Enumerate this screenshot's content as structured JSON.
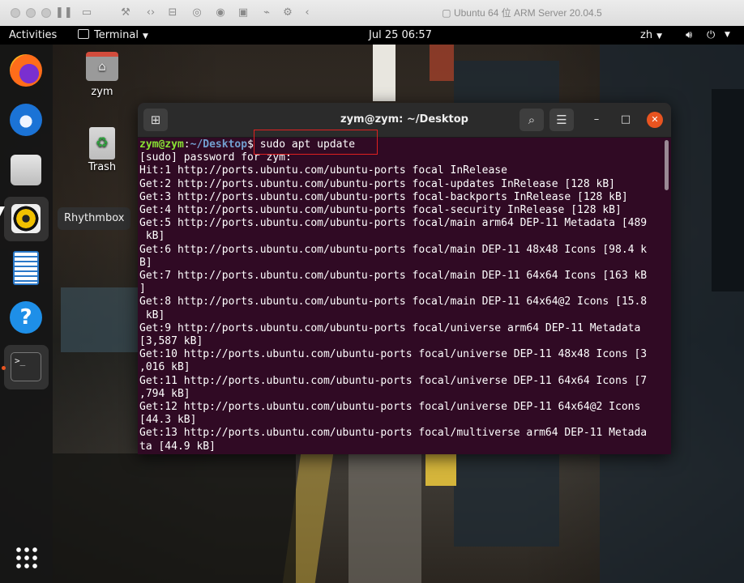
{
  "vm_window": {
    "title": "Ubuntu 64 位 ARM Server 20.04.5"
  },
  "topbar": {
    "activities": "Activities",
    "app_menu": "Terminal",
    "clock": "Jul 25  06:57",
    "input_method": "zh"
  },
  "dock": {
    "tooltip": "Rhythmbox",
    "items": [
      {
        "name": "firefox-icon"
      },
      {
        "name": "thunderbird-icon"
      },
      {
        "name": "files-icon"
      },
      {
        "name": "rhythmbox-icon"
      },
      {
        "name": "libreoffice-writer-icon"
      },
      {
        "name": "help-icon"
      },
      {
        "name": "terminal-icon"
      },
      {
        "name": "show-apps-icon"
      }
    ]
  },
  "desktop_icons": {
    "home": "zym",
    "trash": "Trash"
  },
  "terminal": {
    "title": "zym@zym: ~/Desktop",
    "prompt_user": "zym@zym",
    "prompt_sep": ":",
    "prompt_path": "~/Desktop",
    "prompt_symbol": "$",
    "command": " sudo apt update",
    "lines": [
      "[sudo] password for zym:",
      "Hit:1 http://ports.ubuntu.com/ubuntu-ports focal InRelease",
      "Get:2 http://ports.ubuntu.com/ubuntu-ports focal-updates InRelease [128 kB]",
      "Get:3 http://ports.ubuntu.com/ubuntu-ports focal-backports InRelease [128 kB]",
      "Get:4 http://ports.ubuntu.com/ubuntu-ports focal-security InRelease [128 kB]",
      "Get:5 http://ports.ubuntu.com/ubuntu-ports focal/main arm64 DEP-11 Metadata [489",
      " kB]",
      "Get:6 http://ports.ubuntu.com/ubuntu-ports focal/main DEP-11 48x48 Icons [98.4 k",
      "B]",
      "Get:7 http://ports.ubuntu.com/ubuntu-ports focal/main DEP-11 64x64 Icons [163 kB",
      "]",
      "Get:8 http://ports.ubuntu.com/ubuntu-ports focal/main DEP-11 64x64@2 Icons [15.8",
      " kB]",
      "Get:9 http://ports.ubuntu.com/ubuntu-ports focal/universe arm64 DEP-11 Metadata",
      "[3,587 kB]",
      "Get:10 http://ports.ubuntu.com/ubuntu-ports focal/universe DEP-11 48x48 Icons [3",
      ",016 kB]",
      "Get:11 http://ports.ubuntu.com/ubuntu-ports focal/universe DEP-11 64x64 Icons [7",
      ",794 kB]",
      "Get:12 http://ports.ubuntu.com/ubuntu-ports focal/universe DEP-11 64x64@2 Icons",
      "[44.3 kB]",
      "Get:13 http://ports.ubuntu.com/ubuntu-ports focal/multiverse arm64 DEP-11 Metada",
      "ta [44.9 kB]"
    ]
  },
  "colors": {
    "terminal_bg": "#300a24",
    "prompt_user": "#8ae234",
    "prompt_path": "#729fcf",
    "accent": "#e95420",
    "highlight_box": "#e02020"
  }
}
